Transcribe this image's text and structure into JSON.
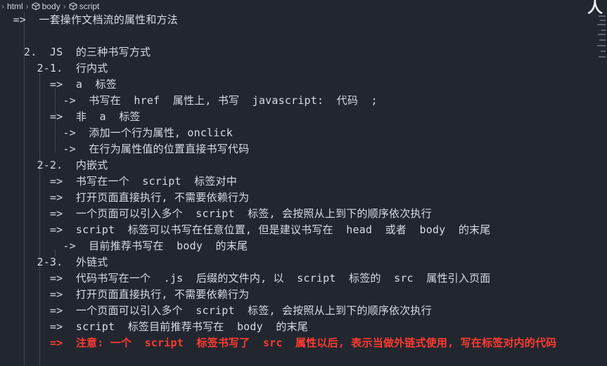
{
  "breadcrumb": {
    "items": [
      "html",
      "body",
      "script"
    ]
  },
  "logo_glyph": "人",
  "code_lines": [
    "  =>  一套操作文档流的属性和方法",
    "",
    "2.  JS  的三种书写方式",
    "  2-1.  行内式",
    "    =>  a  标签",
    "      ->  书写在  href  属性上, 书写  javascript:  代码  ;",
    "    =>  非  a  标签",
    "      ->  添加一个行为属性, onclick",
    "      ->  在行为属性值的位置直接书写代码",
    "  2-2.  内嵌式",
    "    =>  书写在一个  script  标签对中",
    "    =>  打开页面直接执行, 不需要依赖行为",
    "    =>  一个页面可以引入多个  script  标签, 会按照从上到下的顺序依次执行",
    "    =>  script  标签可以书写在任意位置, 但是建议书写在  head  或者  body  的末尾",
    "      ->  目前推荐书写在  body  的末尾",
    "  2-3.  外链式",
    "    =>  代码书写在一个  .js  后缀的文件内, 以  script  标签的  src  属性引入页面",
    "    =>  打开页面直接执行, 不需要依赖行为",
    "    =>  一个页面可以引入多个  script  标签, 会按照从上到下的顺序依次执行",
    "    =>  script  标签目前推荐书写在  body  的末尾",
    "    =>  注意: 一个  script  标签书写了  src  属性以后, 表示当做外链式使用, 写在标签对内的代码"
  ]
}
